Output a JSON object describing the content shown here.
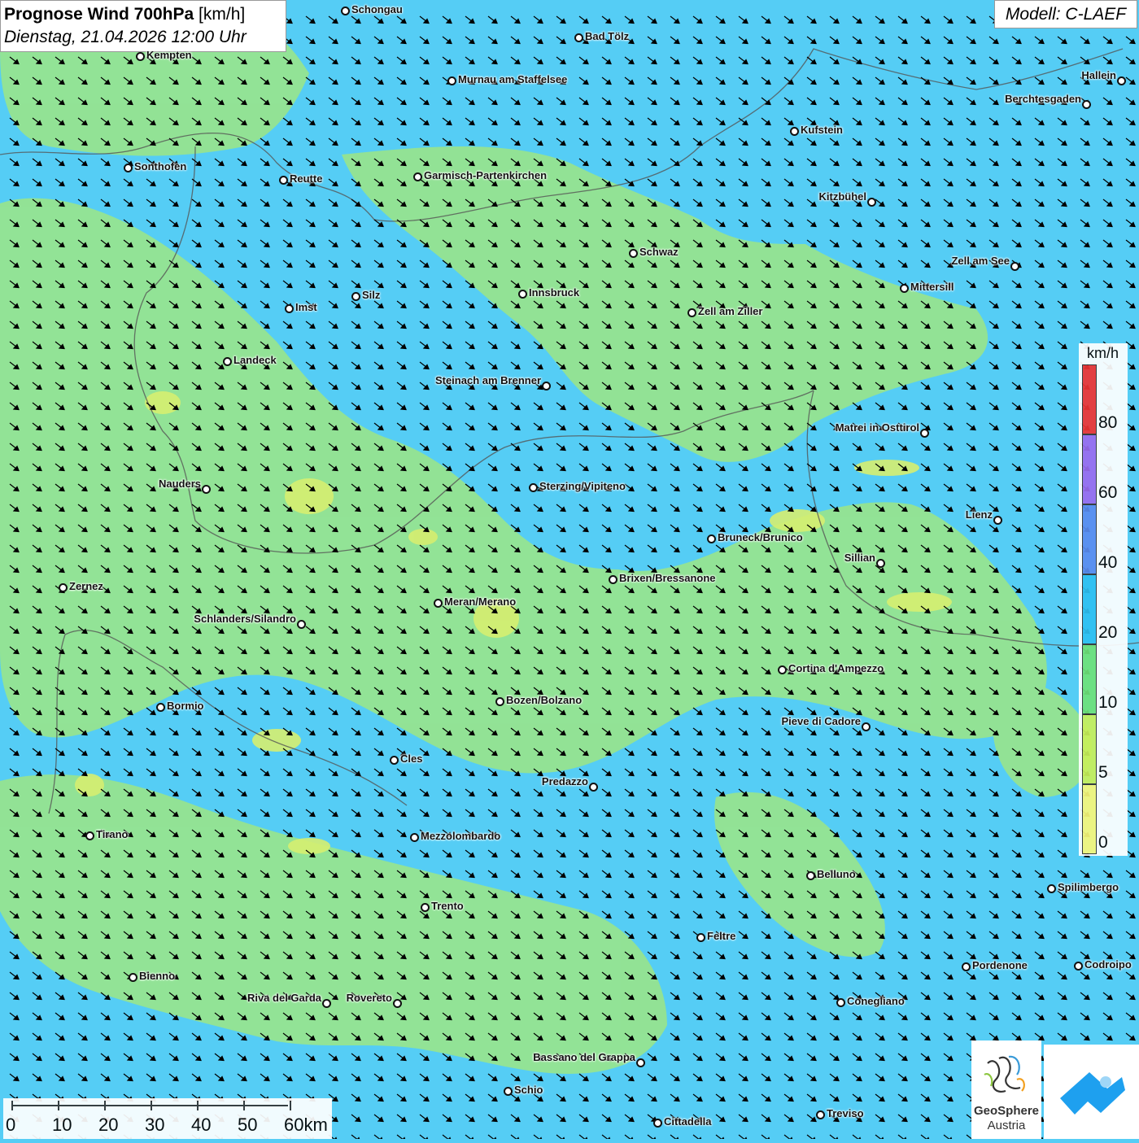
{
  "title": {
    "main": "Prognose Wind 700hPa",
    "unit": "[km/h]",
    "datetime": "Dienstag, 21.04.2026 12:00 Uhr"
  },
  "model": "Modell: C-LAEF",
  "legend": {
    "unit": "km/h",
    "labels": [
      "80",
      "60",
      "40",
      "20",
      "10",
      "5",
      "0"
    ],
    "colors": [
      "#ee3333",
      "#9a6cf0",
      "#5a8cf0",
      "#2ec0f2",
      "#6ee27a",
      "#c8f05a",
      "#f8f87a"
    ]
  },
  "scale": {
    "labels": [
      "0",
      "10",
      "20",
      "30",
      "40",
      "50",
      "60km"
    ]
  },
  "logo": {
    "name": "GeoSphere",
    "sub": "Austria"
  },
  "cities": [
    "Schongau",
    "Bad Tölz",
    "Kempten",
    "Murnau am Staffelsee",
    "Hallein",
    "Berchtesgaden",
    "Kufstein",
    "Sonthofen",
    "Reutte",
    "Garmisch-Partenkirchen",
    "Kitzbühel",
    "Schwaz",
    "Zell am See",
    "Innsbruck",
    "Mittersill",
    "Silz",
    "Imst",
    "Zell am Ziller",
    "Landeck",
    "Steinach am Brenner",
    "Matrei in Osttirol",
    "Nauders",
    "Sterzing/Vipiteno",
    "Lienz",
    "Bruneck/Brunico",
    "Sillian",
    "Brixen/Bressanone",
    "Zernez",
    "Meran/Merano",
    "Schlanders/Silandro",
    "Cortina d'Ampezzo",
    "Bozen/Bolzano",
    "Bormio",
    "Pieve di Cadore",
    "Cles",
    "Predazzo",
    "Tirano",
    "Mezzolombardo",
    "Belluno",
    "Spilimbergo",
    "Trento",
    "Feltre",
    "Pordenone",
    "Codroipo",
    "Bienno",
    "Riva del Garda",
    "Rovereto",
    "Conegliano",
    "Bassano del Grappa",
    "Schio",
    "Treviso",
    "Cittadella"
  ]
}
